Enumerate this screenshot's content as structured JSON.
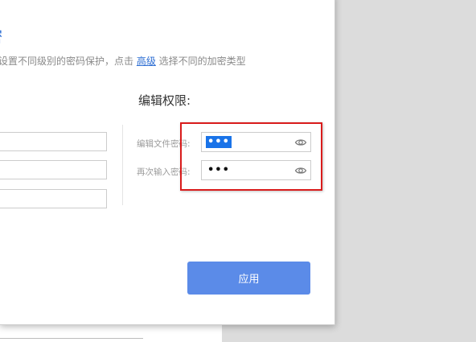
{
  "dialog": {
    "title": "密",
    "description_before": "档设置不同级别的密码保护，点击 ",
    "advanced_link": "高级",
    "description_after": " 选择不同的加密类型"
  },
  "edit_permission": {
    "heading": "编辑权限:",
    "password_label": "编辑文件密码:",
    "password_value": "•••",
    "confirm_label": "再次输入密码:",
    "confirm_value": "•••"
  },
  "apply_button": {
    "label": "应用"
  },
  "colors": {
    "accent": "#2f6fd3",
    "button": "#5b8be8",
    "highlight": "#d91c1c",
    "selection": "#1a73e8"
  },
  "icons": {
    "show_password": "eye-icon"
  }
}
